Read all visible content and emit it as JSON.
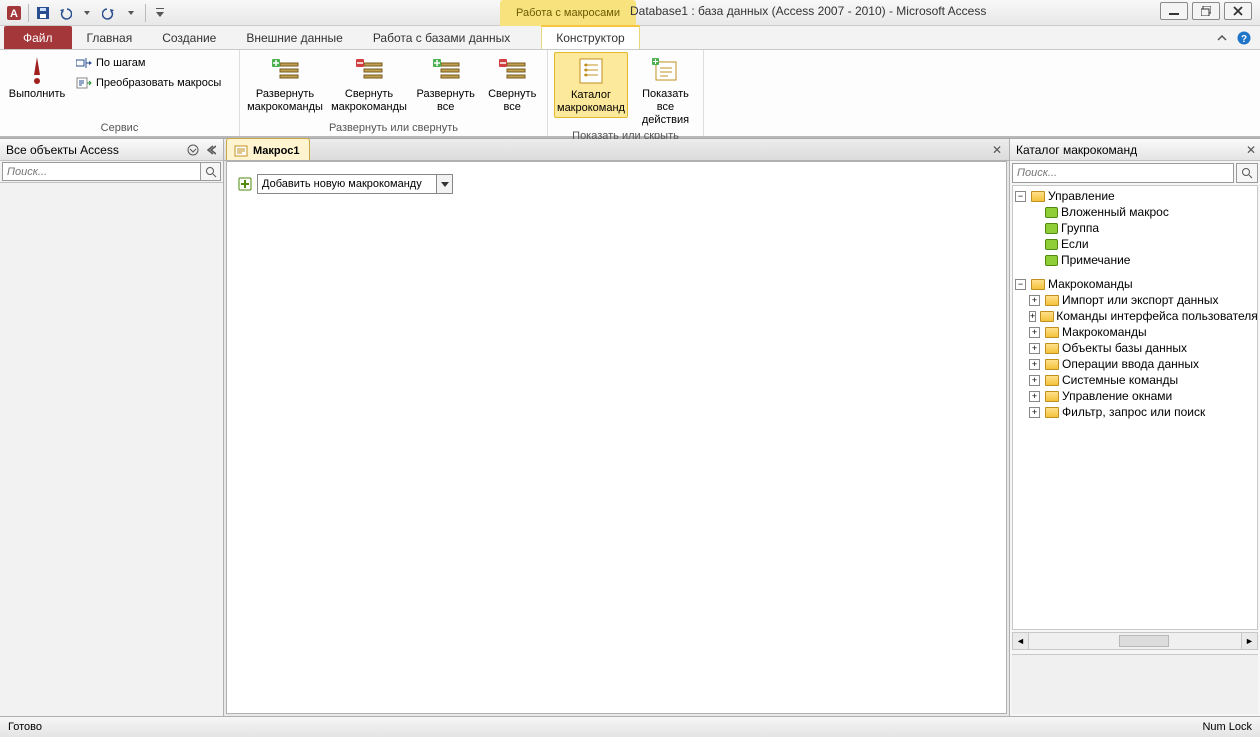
{
  "titlebar": {
    "contextual_label": "Работа с макросами",
    "app_title": "Database1 : база данных (Access 2007 - 2010)  -  Microsoft Access"
  },
  "tabs": {
    "file": "Файл",
    "home": "Главная",
    "create": "Создание",
    "external": "Внешние данные",
    "database": "Работа с базами данных",
    "designer": "Конструктор"
  },
  "ribbon": {
    "run": "Выполнить",
    "step": "По шагам",
    "convert": "Преобразовать макросы",
    "group_tools": "Сервис",
    "expand_macro": "Развернуть макрокоманды",
    "collapse_macro": "Свернуть макрокоманды",
    "expand_all": "Развернуть все",
    "collapse_all": "Свернуть все",
    "group_expand": "Развернуть или свернуть",
    "catalog": "Каталог макрокоманд",
    "show_all": "Показать все действия",
    "group_show": "Показать или скрыть"
  },
  "nav": {
    "title": "Все объекты Access",
    "search_placeholder": "Поиск..."
  },
  "doc": {
    "tab_label": "Макрос1"
  },
  "macro_editor": {
    "add_placeholder": "Добавить новую макрокоманду"
  },
  "catalog": {
    "title": "Каталог макрокоманд",
    "search_placeholder": "Поиск...",
    "control_flow": "Управление",
    "control_items": [
      "Вложенный макрос",
      "Группа",
      "Если",
      "Примечание"
    ],
    "actions": "Макрокоманды",
    "action_groups": [
      "Импорт или экспорт данных",
      "Команды интерфейса пользователя",
      "Макрокоманды",
      "Объекты базы данных",
      "Операции ввода данных",
      "Системные команды",
      "Управление окнами",
      "Фильтр, запрос или поиск"
    ]
  },
  "status": {
    "ready": "Готово",
    "numlock": "Num Lock"
  }
}
